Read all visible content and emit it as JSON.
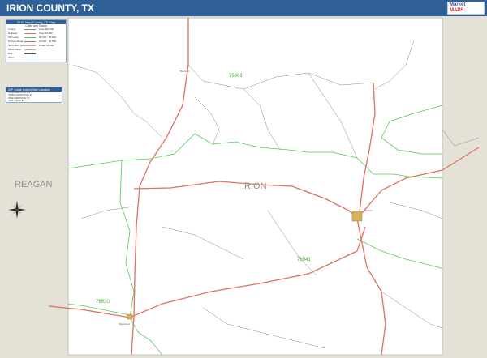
{
  "title": "IRION COUNTY, TX",
  "brand": {
    "line1": "Market",
    "line2": "MAPS"
  },
  "legend": {
    "heading": "2016 Irion County, TX Map",
    "subheading": "Cities and Towns",
    "rows": [
      {
        "left": "County",
        "right": "Over 100,000"
      },
      {
        "left": "Highway",
        "right": "Over 50,000"
      },
      {
        "left": "ZIP Code",
        "right": "25,000 - 50,000"
      },
      {
        "left": "Primary Road",
        "right": "10,000 - 25,000"
      },
      {
        "left": "Secondary Road",
        "right": "Under 10,000"
      },
      {
        "left": "Minor Road",
        "right": ""
      },
      {
        "left": "Rail",
        "right": ""
      },
      {
        "left": "Water",
        "right": ""
      }
    ]
  },
  "zip_locator": {
    "heading": "ZIP Code Index/Grid Locator",
    "rows": [
      "76930   MERTZON   D4",
      "76935   CHRISTOVAL   E5",
      "76941   MERTZON   F3",
      "76957   WALL   E1"
    ]
  },
  "labels": {
    "reagan": "REAGAN",
    "irion": "IRION",
    "zip_76901": "76901",
    "zip_76941": "76941",
    "zip_76930": "76930",
    "mertzon": "Mertzon",
    "sherwood": "Sherwood",
    "barnhart": "Barnhart"
  },
  "colors": {
    "title_bar": "#2e5f96",
    "neighbor_fill": "#e4e2d6",
    "county_fill": "#ffffff",
    "zip_boundary": "#55cc55",
    "highway": "#e07060",
    "minor_road": "#8a8a8a",
    "county_label": "#8f8f8f",
    "city_fill": "#d9b15a"
  },
  "icons": {
    "compass": "compass-rose-icon"
  }
}
